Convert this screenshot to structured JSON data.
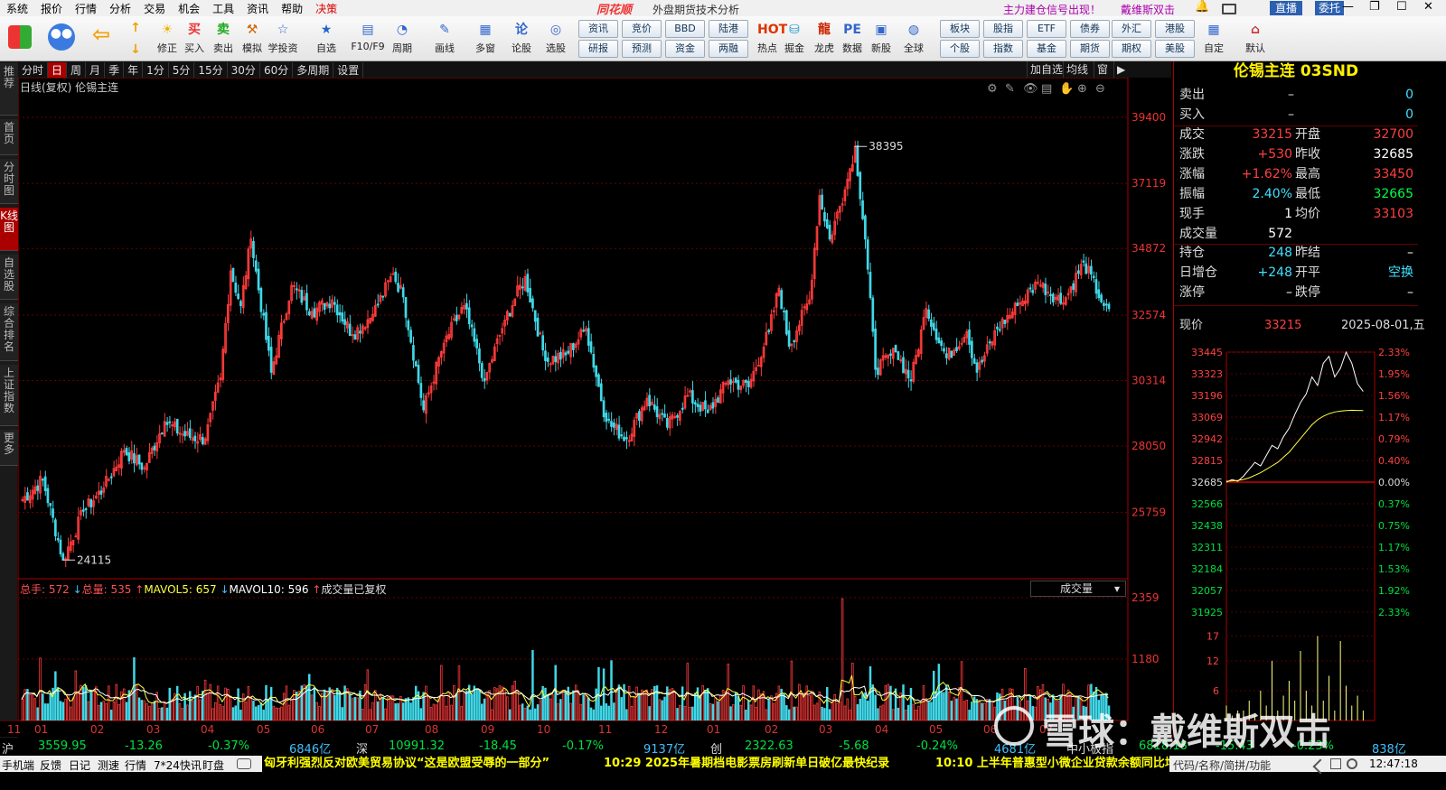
{
  "menu": [
    "系统",
    "报价",
    "行情",
    "分析",
    "交易",
    "机会",
    "工具",
    "资讯",
    "帮助",
    "决策"
  ],
  "logo": "同花顺",
  "app_title": "外盘期货技术分析",
  "alert_text": "主力建仓信号出现！",
  "alert_text2": "戴维斯双击",
  "live_label": "直播",
  "trust_label": "委托",
  "toolbar_big": [
    "修正",
    "买入",
    "卖出",
    "模拟",
    "学投资",
    "自选",
    "F10/F9",
    "周期",
    "画线",
    "多窗",
    "论股",
    "选股",
    "热点",
    "掘金",
    "龙虎",
    "数据",
    "新股",
    "全球",
    "自定",
    "默认"
  ],
  "toolbar_small_top": [
    "资讯",
    "竞价",
    "BBD",
    "陆港",
    "板块",
    "股指",
    "ETF",
    "债券",
    "外汇",
    "港股"
  ],
  "toolbar_small_bot": [
    "研报",
    "预测",
    "资金",
    "两融",
    "个股",
    "指数",
    "基金",
    "期货",
    "期权",
    "美股"
  ],
  "icon_labels": {
    "up": "↑",
    "down": "↓",
    "buy": "买",
    "sell": "卖",
    "hot": "HOT"
  },
  "left_tabs": [
    "推荐",
    "首页",
    "分时图",
    "K线图",
    "自选股",
    "综合排名",
    "上证指数",
    "更多"
  ],
  "periods": [
    "分时",
    "日",
    "周",
    "月",
    "季",
    "年",
    "1分",
    "5分",
    "15分",
    "30分",
    "60分",
    "多周期",
    "设置"
  ],
  "right_btns": [
    "加自选",
    "均线",
    "窗",
    "▶"
  ],
  "chart_title": "日线(复权)  伦锡主连",
  "vol_header": {
    "total": "总手: 572",
    "totvol": "总量: 535",
    "ma5": "MAVOL5: 657",
    "ma10": "MAVOL10: 596",
    "note": "成交量已复权"
  },
  "vol_selector": "成交量",
  "quote": {
    "title": "伦锡主连 03SND",
    "sell": {
      "label": "卖出",
      "price": "–",
      "vol": "0"
    },
    "buy": {
      "label": "买入",
      "price": "–",
      "vol": "0"
    },
    "rows": [
      {
        "l1": "成交",
        "v1": "33215",
        "c1": "#ff4040",
        "l2": "开盘",
        "v2": "32700",
        "c2": "#ff4040"
      },
      {
        "l1": "涨跌",
        "v1": "+530",
        "c1": "#ff4040",
        "l2": "昨收",
        "v2": "32685",
        "c2": "#ffffff"
      },
      {
        "l1": "涨幅",
        "v1": "+1.62%",
        "c1": "#ff4040",
        "l2": "最高",
        "v2": "33450",
        "c2": "#ff4040"
      },
      {
        "l1": "振幅",
        "v1": "2.40%",
        "c1": "#40e0ff",
        "l2": "最低",
        "v2": "32665",
        "c2": "#00ff40"
      },
      {
        "l1": "现手",
        "v1": "1",
        "c1": "#ffffff",
        "l2": "均价",
        "v2": "33103",
        "c2": "#ff4040"
      },
      {
        "l1": "成交量",
        "v1": "572",
        "c1": "#ffffff",
        "l2": "",
        "v2": "",
        "c2": "#ffffff"
      }
    ],
    "rows2": [
      {
        "l1": "持仓",
        "v1": "248",
        "c1": "#40e0ff",
        "l2": "昨结",
        "v2": "–",
        "c2": "#ffffff"
      },
      {
        "l1": "日增仓",
        "v1": "+248",
        "c1": "#40e0ff",
        "l2": "开平",
        "v2": "空换",
        "c2": "#40e0ff"
      },
      {
        "l1": "涨停",
        "v1": "–",
        "c1": "#ffffff",
        "l2": "跌停",
        "v2": "–",
        "c2": "#ffffff"
      }
    ],
    "now_label": "现价",
    "now_price": "33215",
    "now_date": "2025-08-01,五"
  },
  "mini_price_ticks": [
    "33445",
    "33323",
    "33196",
    "33069",
    "32942",
    "32815",
    "32685",
    "32566",
    "32438",
    "32311",
    "32184",
    "32057",
    "31925"
  ],
  "mini_pct_ticks": [
    "2.33%",
    "1.95%",
    "1.56%",
    "1.17%",
    "0.79%",
    "0.40%",
    "0.00%",
    "0.37%",
    "0.75%",
    "1.17%",
    "1.53%",
    "1.92%",
    "2.33%"
  ],
  "mini_vol_ticks": [
    "17",
    "12",
    "6"
  ],
  "mini_intraday": {
    "price": [
      32685,
      32700,
      32690,
      32720,
      32760,
      32800,
      32780,
      32840,
      32900,
      32880,
      32950,
      33000,
      33080,
      33150,
      33200,
      33300,
      33250,
      33380,
      33420,
      33300,
      33350,
      33445,
      33380,
      33260,
      33215
    ],
    "avg": [
      32690,
      32692,
      32695,
      32700,
      32710,
      32725,
      32740,
      32760,
      32780,
      32800,
      32830,
      32860,
      32900,
      32940,
      32980,
      33020,
      33050,
      33070,
      33085,
      33095,
      33100,
      33103,
      33105,
      33104,
      33103
    ],
    "vol": [
      3,
      1,
      2,
      2,
      4,
      1,
      6,
      3,
      12,
      2,
      5,
      8,
      4,
      14,
      6,
      3,
      17,
      4,
      9,
      2,
      16,
      7,
      3,
      5,
      2
    ]
  },
  "y_ticks": [
    "39400",
    "37119",
    "34872",
    "32574",
    "30314",
    "28050",
    "25759"
  ],
  "vol_ticks": [
    "2359",
    "1180"
  ],
  "x_months": [
    "11",
    "01",
    "02",
    "03",
    "04",
    "05",
    "06",
    "07",
    "08",
    "09",
    "10",
    "11",
    "12",
    "01",
    "02",
    "03",
    "04",
    "05",
    "06",
    "07"
  ],
  "chart_data": {
    "type": "candlestick",
    "title": "日线(复权) 伦锡主连",
    "ylim": [
      23500,
      39400
    ],
    "vol_max": 2359,
    "max_label": "38395",
    "min_label": "24115",
    "anchors": [
      [
        0,
        26200
      ],
      [
        8,
        26900
      ],
      [
        16,
        24115
      ],
      [
        24,
        25800
      ],
      [
        32,
        26600
      ],
      [
        40,
        27900
      ],
      [
        48,
        27300
      ],
      [
        56,
        28900
      ],
      [
        64,
        28400
      ],
      [
        72,
        28300
      ],
      [
        78,
        30400
      ],
      [
        82,
        34100
      ],
      [
        86,
        32900
      ],
      [
        90,
        35200
      ],
      [
        98,
        30600
      ],
      [
        106,
        33600
      ],
      [
        114,
        32700
      ],
      [
        122,
        33100
      ],
      [
        130,
        31900
      ],
      [
        138,
        32600
      ],
      [
        146,
        34000
      ],
      [
        150,
        33200
      ],
      [
        158,
        29300
      ],
      [
        166,
        31600
      ],
      [
        174,
        32900
      ],
      [
        182,
        30300
      ],
      [
        190,
        32400
      ],
      [
        198,
        33900
      ],
      [
        206,
        31000
      ],
      [
        214,
        31200
      ],
      [
        222,
        32100
      ],
      [
        230,
        28900
      ],
      [
        238,
        28300
      ],
      [
        246,
        29700
      ],
      [
        254,
        28700
      ],
      [
        262,
        29800
      ],
      [
        270,
        29200
      ],
      [
        278,
        30300
      ],
      [
        286,
        30100
      ],
      [
        294,
        32000
      ],
      [
        298,
        33500
      ],
      [
        302,
        31500
      ],
      [
        310,
        33100
      ],
      [
        314,
        36700
      ],
      [
        318,
        35200
      ],
      [
        324,
        36900
      ],
      [
        328,
        38395
      ],
      [
        332,
        35200
      ],
      [
        336,
        30700
      ],
      [
        344,
        31300
      ],
      [
        350,
        30300
      ],
      [
        356,
        32800
      ],
      [
        364,
        31100
      ],
      [
        372,
        32000
      ],
      [
        376,
        30600
      ],
      [
        384,
        32100
      ],
      [
        392,
        32900
      ],
      [
        400,
        33700
      ],
      [
        410,
        33000
      ],
      [
        418,
        34400
      ],
      [
        426,
        32900
      ],
      [
        428,
        32800
      ]
    ]
  },
  "index_bar": {
    "sh": {
      "name": "沪",
      "v": "3559.95",
      "chg": "-13.26",
      "pct": "-0.37%",
      "amt": "6846亿"
    },
    "sz": {
      "name": "深",
      "v": "10991.32",
      "chg": "-18.45",
      "pct": "-0.17%",
      "amt": "9137亿"
    },
    "cy": {
      "name": "创",
      "v": "2322.63",
      "chg": "-5.68",
      "pct": "-0.24%",
      "amt": "4681亿"
    },
    "zx": {
      "name": "中小板指",
      "v": "6818.18",
      "chg": "-15.43",
      "pct": "-0.23%",
      "amt": "838亿"
    }
  },
  "status_left": [
    "手机端",
    "反馈",
    "日记",
    "测速",
    "行情",
    "7*24快讯",
    "盯盘"
  ],
  "ticker": [
    "匈牙利强烈反对欧美贸易协议“这是欧盟受辱的一部分”",
    "10:29 2025年暑期档电影票房刷新单日破亿最快纪录",
    "10:10 上半年普惠型小微企业贷款余额同比增"
  ],
  "status_right": {
    "search": "代码/名称/简拼/功能",
    "time": "12:47:18"
  },
  "watermark": "雪球：戴维斯双击"
}
